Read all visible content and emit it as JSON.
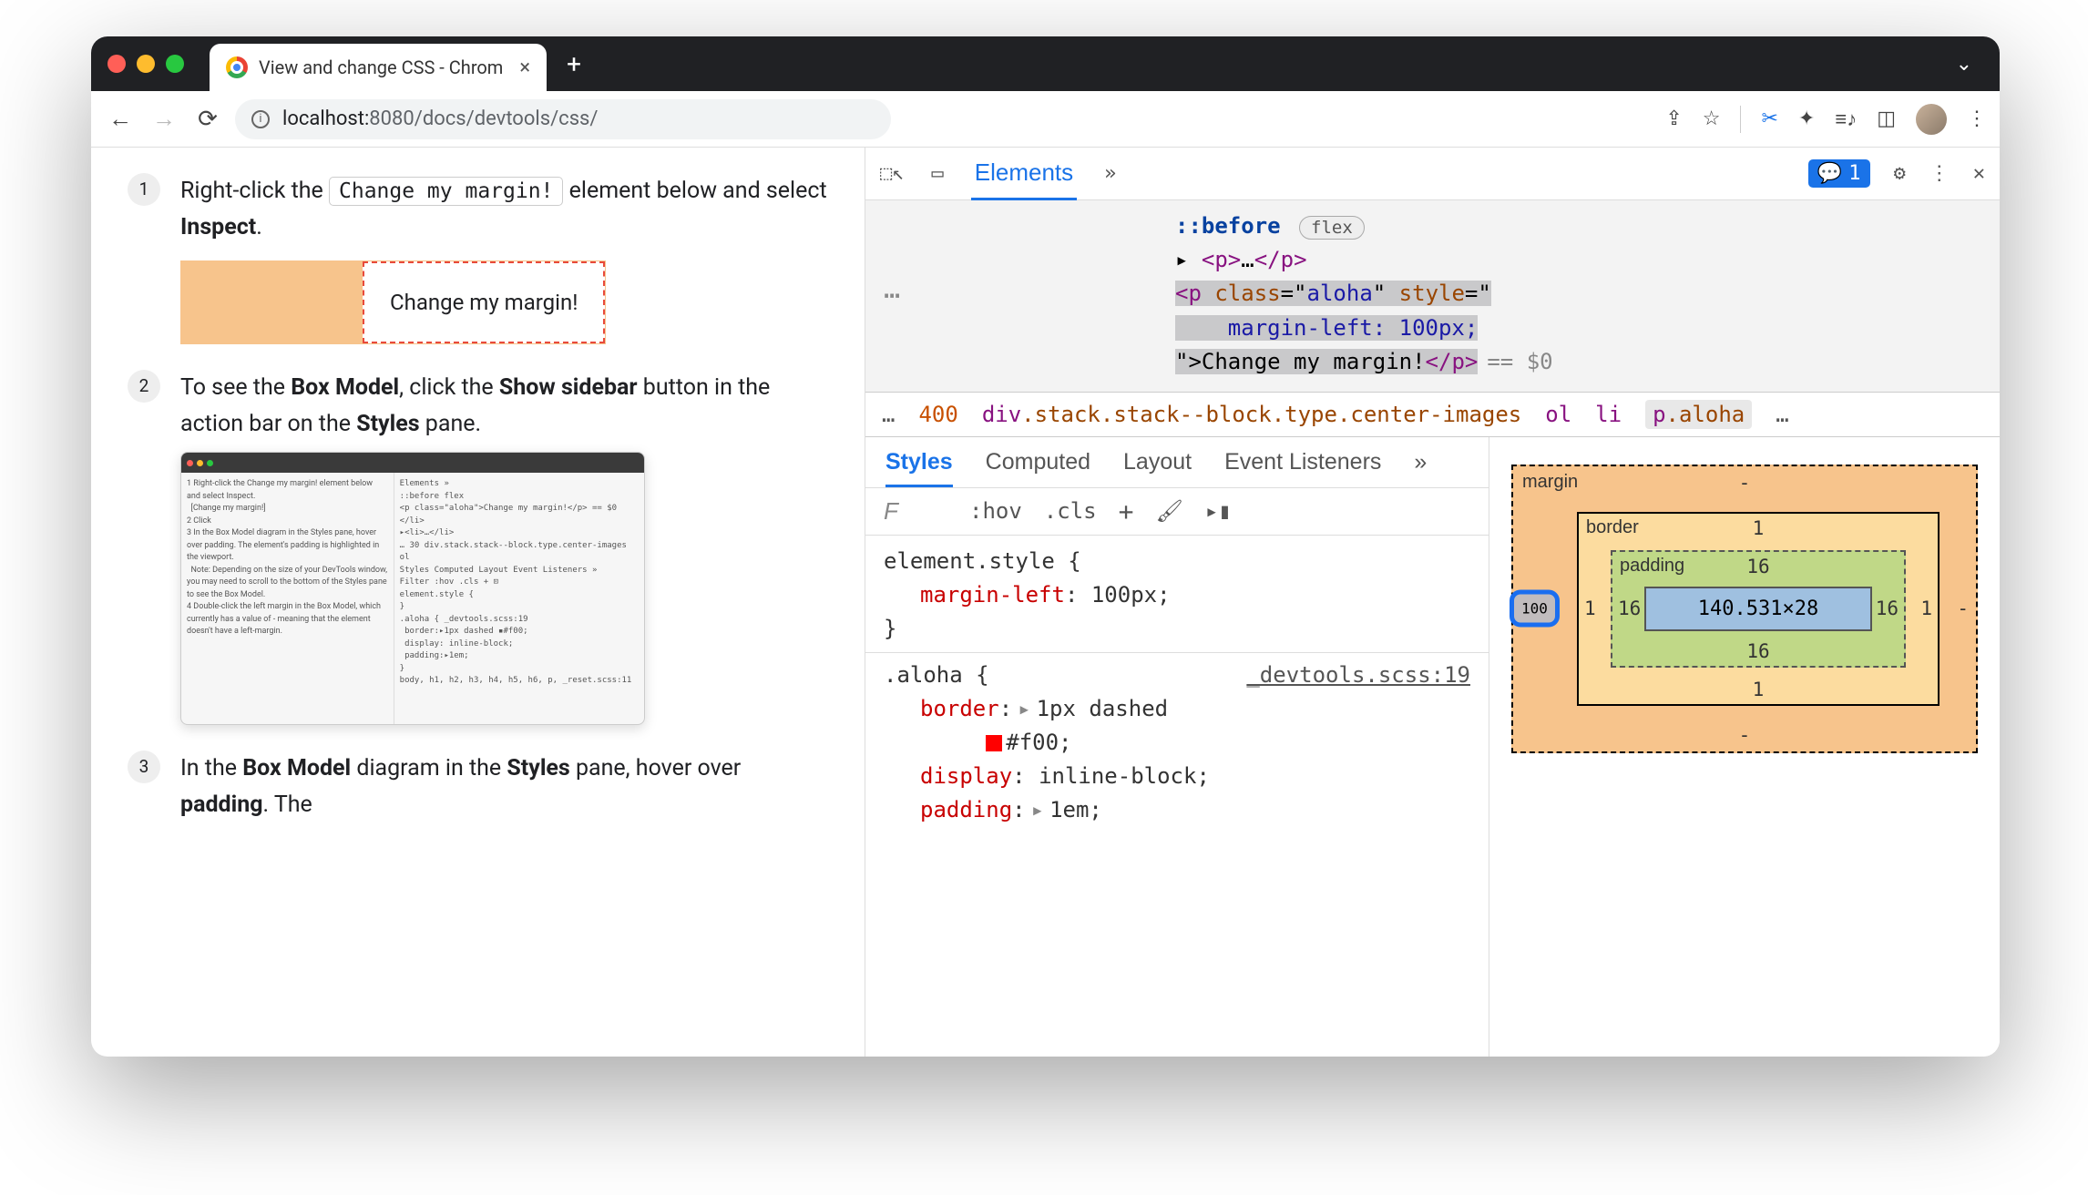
{
  "browser": {
    "tab_title": "View and change CSS - Chrom",
    "url_host": "localhost:",
    "url_port": "8080",
    "url_path": "/docs/devtools/css/"
  },
  "doc": {
    "step1_a": "Right-click the ",
    "step1_kbd": "Change my margin!",
    "step1_b": " element below and select ",
    "step1_bold": "Inspect",
    "step1_c": ".",
    "demo_text": "Change my margin!",
    "step2_a": "To see the ",
    "step2_b1": "Box Model",
    "step2_c": ", click the ",
    "step2_b2": "Show sidebar",
    "step2_d": " button in the action bar on the ",
    "step2_b3": "Styles",
    "step2_e": " pane.",
    "step3_a": "In the ",
    "step3_b1": "Box Model",
    "step3_b": " diagram in the ",
    "step3_b2": "Styles",
    "step3_c": " pane, hover over ",
    "step3_b3": "padding",
    "step3_d": ". The"
  },
  "devtools": {
    "elements_tab": "Elements",
    "issues_count": "1",
    "dom": {
      "before": "::before",
      "flex": "flex",
      "p_collapsed": "<p>…</p>",
      "sel_open": "<p class=\"aloha\" style=\"",
      "sel_style": "margin-left: 100px;",
      "sel_close": "\">Change my margin!</p>",
      "eq0": "== $0"
    },
    "crumbs": {
      "dots": "…",
      "c400": "400",
      "c_div": "div.stack.stack--block.type.center-images",
      "c_ol": "ol",
      "c_li": "li",
      "c_p": "p.aloha",
      "dots2": "…"
    },
    "styles_tabs": {
      "styles": "Styles",
      "computed": "Computed",
      "layout": "Layout",
      "listeners": "Event Listeners"
    },
    "styles_bar": {
      "filter": "F",
      "hov": ":hov",
      "cls": ".cls",
      "plus": "+"
    },
    "rules": {
      "r1_sel": "element.style {",
      "r1_p1n": "margin-left",
      "r1_p1v": "100px",
      "close": "}",
      "r2_sel": ".aloha {",
      "r2_src": "_devtools.scss:19",
      "r2_p1n": "border",
      "r2_p1v": "1px dashed",
      "r2_p1c": "#f00",
      "r2_p2n": "display",
      "r2_p2v": "inline-block",
      "r2_p3n": "padding",
      "r2_p3v": "1em"
    },
    "boxmodel": {
      "margin_label": "margin",
      "border_label": "border",
      "padding_label": "padding",
      "m_top": "-",
      "m_right": "-",
      "m_bottom": "-",
      "m_left": "100",
      "b_top": "1",
      "b_right": "1",
      "b_bottom": "1",
      "b_left": "1",
      "p_top": "16",
      "p_right": "16",
      "p_bottom": "16",
      "p_left": "16",
      "content": "140.531×28"
    }
  }
}
